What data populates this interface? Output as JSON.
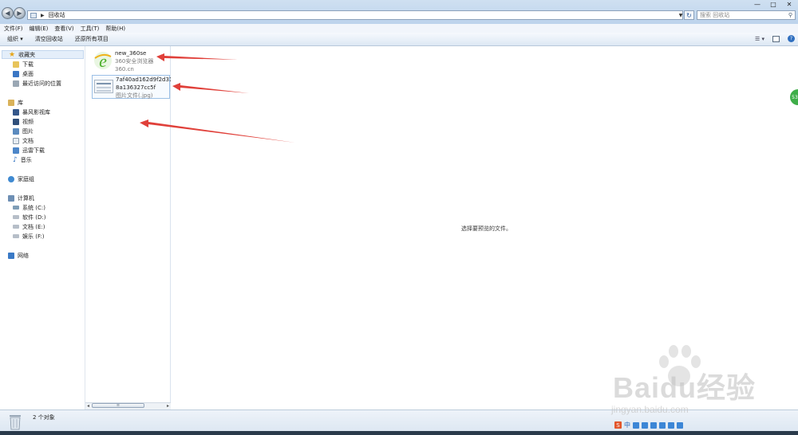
{
  "window": {
    "breadcrumb": "回收站",
    "search_placeholder": "搜索 回收站",
    "min_label": "—",
    "max_label": "□",
    "close_label": "✕"
  },
  "menu": [
    "文件(F)",
    "编辑(E)",
    "查看(V)",
    "工具(T)",
    "帮助(H)"
  ],
  "toolbar": {
    "organize_label": "组织 ▾",
    "empty_bin_label": "清空回收站",
    "restore_all_label": "还原所有项目"
  },
  "nav": {
    "favorites": {
      "label": "收藏夹",
      "items": [
        "下载",
        "桌面",
        "最近访问的位置"
      ]
    },
    "library": {
      "label": "库",
      "items": [
        "暴风影视库",
        "视频",
        "图片",
        "文档",
        "迅雷下载",
        "音乐"
      ]
    },
    "homegroup": "家庭组",
    "computer": {
      "label": "计算机",
      "drives": [
        "系统 (C:)",
        "软件 (D:)",
        "文档 (E:)",
        "娱乐 (F:)"
      ]
    },
    "network": "网络"
  },
  "files": [
    {
      "name": "new_360se",
      "line2": "360安全浏览器",
      "line3": "360.cn",
      "icon": "360-browser-icon"
    },
    {
      "name": "7af40ad162d9f2d313a",
      "line2": "8a136327cc5f",
      "line3": "图片文件(.jpg)",
      "icon": "image-thumbnail-icon"
    }
  ],
  "preview_message": "选择要预览的文件。",
  "status": {
    "count_text": "2 个对象"
  },
  "watermark": {
    "brand": "Baidu经验",
    "url": "jingyan.baidu.com"
  },
  "side_badge": "53",
  "ime": {
    "mode": "中"
  },
  "colors": {
    "arrow_red": "#e0403a",
    "selection_border": "#9cc0e6",
    "ie_green": "#4caf2a"
  }
}
